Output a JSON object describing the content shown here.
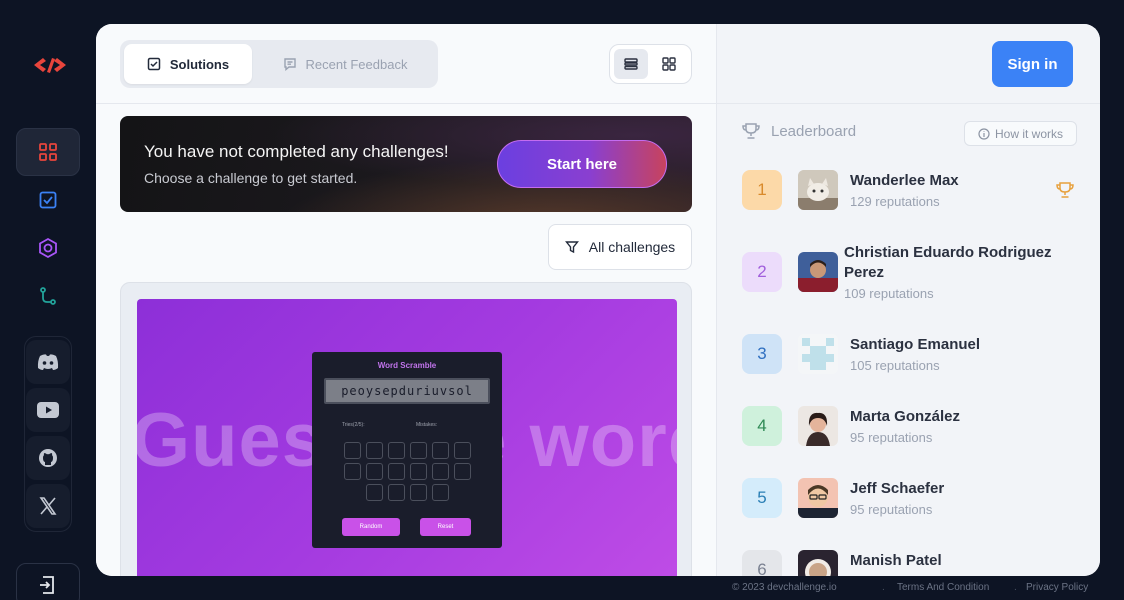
{
  "nav": {
    "items": [
      {
        "icon": "dashboard-grid-icon",
        "active": true
      },
      {
        "icon": "checklist-icon",
        "active": false
      },
      {
        "icon": "challenges-icon",
        "active": false
      },
      {
        "icon": "roadmap-icon",
        "active": false
      }
    ],
    "social": [
      "discord-icon",
      "youtube-icon",
      "github-icon",
      "x-icon"
    ],
    "logout_icon": "logout-icon"
  },
  "toolbar": {
    "tabs": [
      {
        "label": "Solutions",
        "icon": "checklist-icon",
        "active": true
      },
      {
        "label": "Recent Feedback",
        "icon": "chat-icon",
        "active": false
      }
    ],
    "view_modes": [
      "list-view-icon",
      "grid-view-icon"
    ]
  },
  "banner": {
    "title": "You have not completed any challenges!",
    "subtitle": "Choose a challenge to get started.",
    "cta": "Start here"
  },
  "filter": {
    "label": "All challenges"
  },
  "preview": {
    "background_word": "Guess the word",
    "game_title": "Word Scramble",
    "scrambled": "peoysepduriuvsol",
    "tries_label": "Tries(2/5):",
    "mistakes_label": "Mistakes:",
    "random_label": "Random",
    "reset_label": "Reset"
  },
  "auth": {
    "signin": "Sign in"
  },
  "leaderboard": {
    "title": "Leaderboard",
    "how_it_works": "How it works",
    "entries": [
      {
        "rank": "1",
        "name": "Wanderlee Max",
        "reputation": "129 reputations",
        "badge": "#fcd9a8",
        "text": "#d98a2b"
      },
      {
        "rank": "2",
        "name_line1": "Christian Eduardo Rodriguez",
        "name_line2": "Perez",
        "reputation": "109 reputations",
        "badge": "#ecdcfb",
        "text": "#a15fdc"
      },
      {
        "rank": "3",
        "name": "Santiago Emanuel",
        "reputation": "105 reputations",
        "badge": "#cfe3f7",
        "text": "#2f6fc0"
      },
      {
        "rank": "4",
        "name": "Marta González",
        "reputation": "95 reputations",
        "badge": "#cff1dc",
        "text": "#2f8a55"
      },
      {
        "rank": "5",
        "name": "Jeff Schaefer",
        "reputation": "95 reputations",
        "badge": "#d4ecfb",
        "text": "#2a7fb5"
      },
      {
        "rank": "6",
        "name": "Manish Patel",
        "reputation": "",
        "badge": "#e4e6ea",
        "text": "#7a8191"
      }
    ]
  },
  "footer": {
    "copyright": "© 2023 devchallenge.io",
    "terms": "Terms And Condition",
    "privacy": "Privacy Policy"
  }
}
